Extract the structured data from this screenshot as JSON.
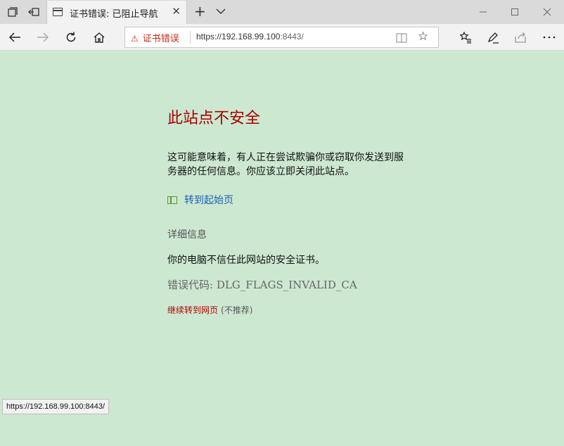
{
  "tab": {
    "title": "证书错误: 已阻止导航"
  },
  "address_bar": {
    "cert_error": "证书错误",
    "url_main": "https://192.168.99.100",
    "url_port": ":8443/"
  },
  "page": {
    "heading": "此站点不安全",
    "description": "这可能意味着，有人正在尝试欺骗你或窃取你发送到服务器的任何信息。你应该立即关闭此站点。",
    "home_link": "转到起始页",
    "details": "详细信息",
    "pc_message": "你的电脑不信任此网站的安全证书。",
    "error_code": "错误代码: DLG_FLAGS_INVALID_CA",
    "continue_link": "继续转到网页",
    "not_recommended": "(不推荐)"
  },
  "status_bar": {
    "url": "https://192.168.99.100:8443/"
  },
  "colors": {
    "page_bg": "#cde8d1",
    "heading": "#a80000",
    "link": "#1a5fb4",
    "cert_warning": "#c42b1c"
  },
  "icons": [
    "tab-manager-icon",
    "set-aside-tabs-icon",
    "page-icon",
    "close-icon",
    "new-tab-icon",
    "chevron-down-icon",
    "minimize-icon",
    "maximize-icon",
    "back-icon",
    "forward-icon",
    "refresh-icon",
    "home-icon",
    "warning-icon",
    "reading-view-icon",
    "star-icon",
    "favorites-icon",
    "pen-icon",
    "share-icon",
    "more-icon"
  ]
}
